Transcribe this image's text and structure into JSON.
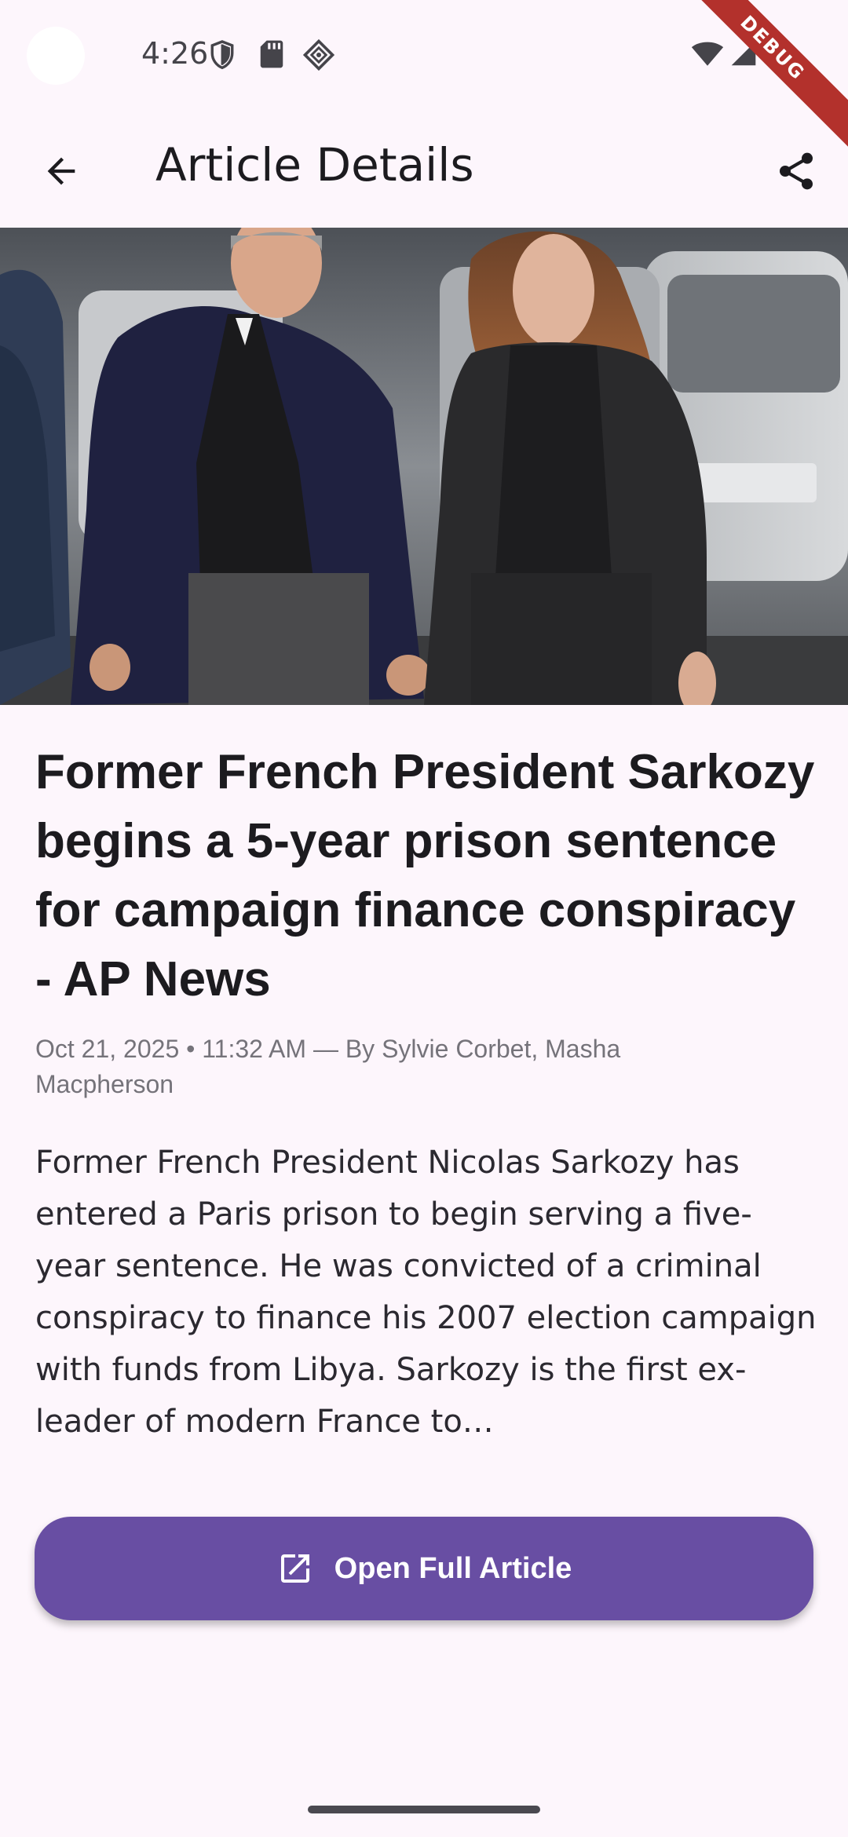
{
  "status_bar": {
    "time": "4:26",
    "icons": [
      "shield-icon",
      "sd-card-icon",
      "vpn-icon",
      "wifi-icon",
      "signal-icon",
      "battery-icon"
    ],
    "debug_banner": "DEBUG"
  },
  "app_bar": {
    "title": "Article Details",
    "back_icon": "arrow-back-icon",
    "share_icon": "share-icon"
  },
  "article": {
    "headline": "Former French President Sarkozy begins a 5-year prison sentence for campaign finance conspiracy - AP News",
    "meta": "Oct 21, 2025 • 11:32 AM — By Sylvie Corbet, Masha Macpherson",
    "summary": "Former French President Nicolas Sarkozy has entered a Paris prison to begin serving a five-year sentence. He was convicted of a criminal conspiracy to finance his 2007 election campaign with funds from Libya. Sarkozy is the first ex-leader of modern France to…"
  },
  "actions": {
    "open_full_article": "Open Full Article",
    "open_icon": "open-in-new-icon"
  },
  "colors": {
    "background": "#fdf6fc",
    "primary": "#684ea3",
    "debug": "#b3312c",
    "meta_text": "#75737a"
  }
}
